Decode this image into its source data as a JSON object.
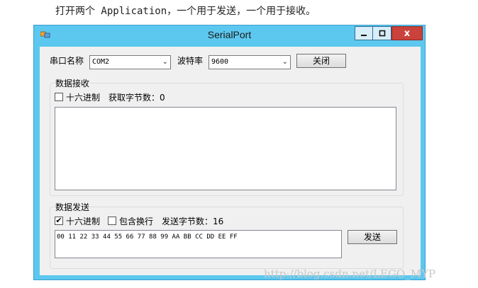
{
  "caption": "打开两个 Application，一个用于发送，一个用于接收。",
  "window": {
    "title": "SerialPort",
    "controls": {
      "minimize": "▁",
      "maximize": "□",
      "close": "x"
    }
  },
  "top_row": {
    "port_label": "串口名称",
    "port_value": "COM2",
    "baud_label": "波特率",
    "baud_value": "9600",
    "close_button": "关闭"
  },
  "receive": {
    "group_title": "数据接收",
    "hex_label": "十六进制",
    "hex_checked": false,
    "bytes_label": "获取字节数：0",
    "content": ""
  },
  "send": {
    "group_title": "数据发送",
    "hex_label": "十六进制",
    "hex_checked": true,
    "newline_label": "包含换行",
    "newline_checked": false,
    "bytes_label": "发送字节数：16",
    "content": "00 11 22 33 44 55 66 77 88 99 AA BB CC DD EE FF",
    "send_button": "发送"
  },
  "watermark": "http://blog.csdn.net/LEGO_MYP"
}
